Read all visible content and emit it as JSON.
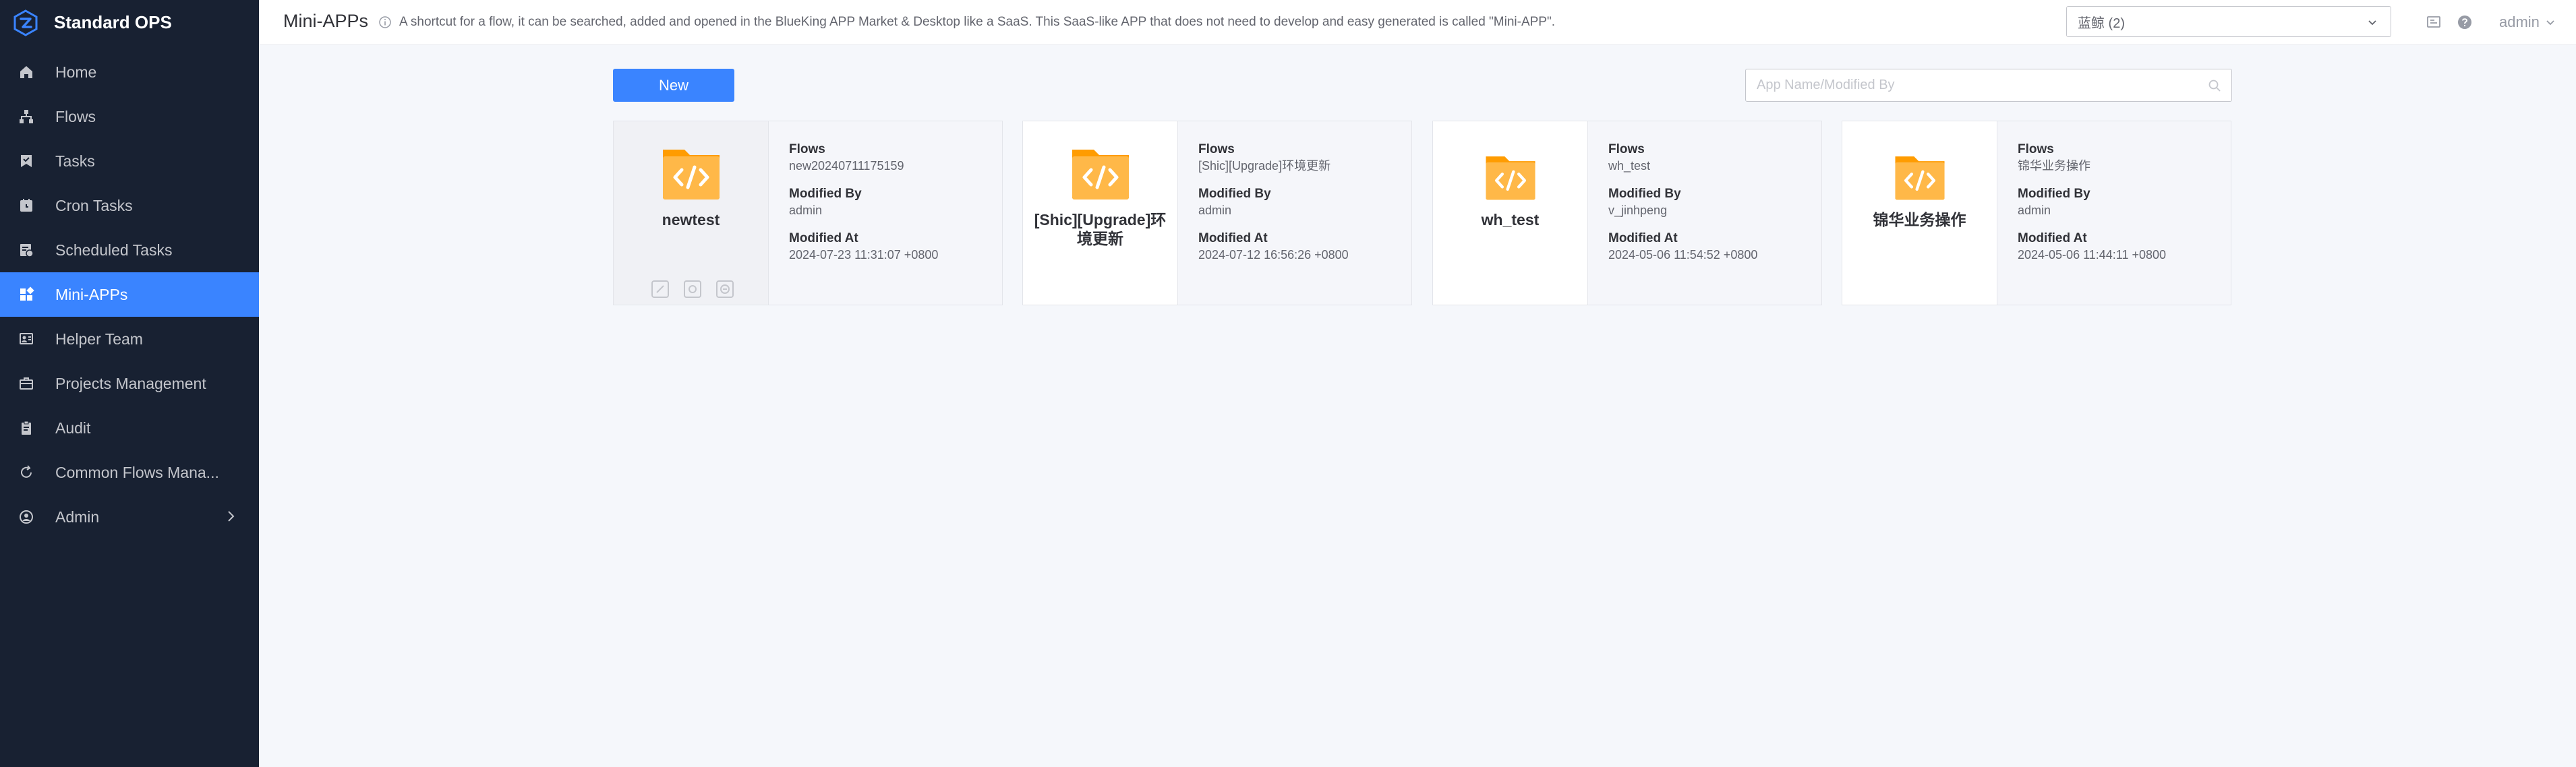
{
  "app": {
    "title": "Standard OPS"
  },
  "sidebar": {
    "items": [
      {
        "label": "Home",
        "icon": "home-icon"
      },
      {
        "label": "Flows",
        "icon": "flows-icon"
      },
      {
        "label": "Tasks",
        "icon": "tasks-icon"
      },
      {
        "label": "Cron Tasks",
        "icon": "cron-icon"
      },
      {
        "label": "Scheduled Tasks",
        "icon": "scheduled-icon"
      },
      {
        "label": "Mini-APPs",
        "icon": "grid-icon",
        "active": true
      },
      {
        "label": "Helper Team",
        "icon": "team-icon"
      },
      {
        "label": "Projects Management",
        "icon": "briefcase-icon"
      },
      {
        "label": "Audit",
        "icon": "clipboard-icon"
      },
      {
        "label": "Common Flows Mana...",
        "icon": "cycle-icon"
      },
      {
        "label": "Admin",
        "icon": "user-circle-icon"
      }
    ]
  },
  "header": {
    "title": "Mini-APPs",
    "description": "A shortcut for a flow, it can be searched, added and opened in the BlueKing APP Market & Desktop like a SaaS. This SaaS-like APP that does not need to develop and easy generated is called \"Mini-APP\".",
    "project_select": "蓝鲸 (2)",
    "user": "admin"
  },
  "toolbar": {
    "new_label": "New",
    "search_placeholder": "App Name/Modified By"
  },
  "labels": {
    "flows": "Flows",
    "modified_by": "Modified By",
    "modified_at": "Modified At"
  },
  "cards": [
    {
      "name": "newtest",
      "flow": "new20240711175159",
      "modified_by": "admin",
      "modified_at": "2024-07-23 11:31:07 +0800"
    },
    {
      "name": "[Shic][Upgrade]环境更新",
      "flow": "[Shic][Upgrade]环境更新",
      "modified_by": "admin",
      "modified_at": "2024-07-12 16:56:26 +0800"
    },
    {
      "name": "wh_test",
      "flow": "wh_test",
      "modified_by": "v_jinhpeng",
      "modified_at": "2024-05-06 11:54:52 +0800"
    },
    {
      "name": "锦华业务操作",
      "flow": "锦华业务操作",
      "modified_by": "admin",
      "modified_at": "2024-05-06 11:44:11 +0800"
    }
  ],
  "colors": {
    "sidebar_bg": "#182132",
    "accent": "#3a84ff",
    "folder": "#ffb848",
    "folder_dark": "#ff9c01"
  }
}
